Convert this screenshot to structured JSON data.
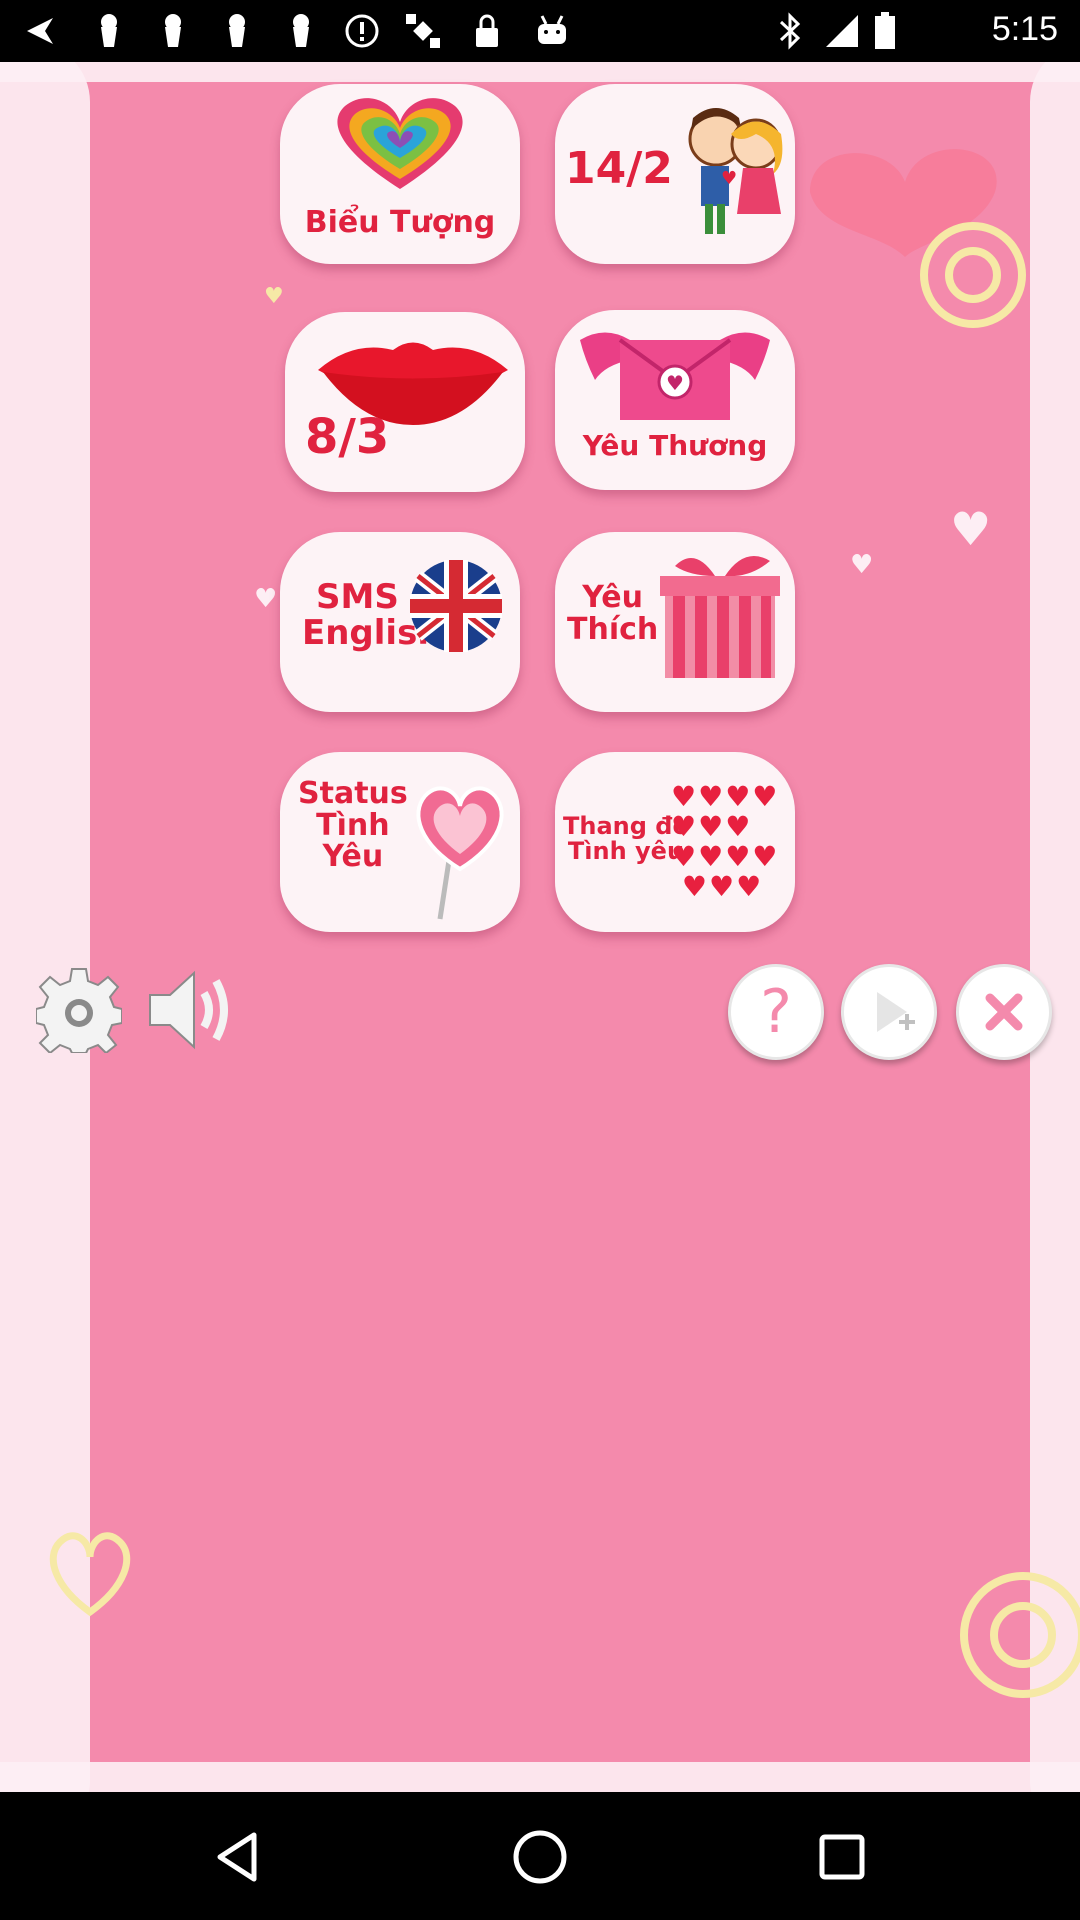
{
  "status_bar": {
    "time": "5:15",
    "icons": [
      "back-arrow-icon",
      "notification-icon",
      "notification-icon",
      "notification-icon",
      "notification-icon",
      "alert-icon",
      "gps-icon",
      "lock-icon",
      "android-icon",
      "bluetooth-icon",
      "signal-icon",
      "battery-icon"
    ]
  },
  "tiles": [
    {
      "id": "bieu-tuong",
      "label": "Biểu Tượng"
    },
    {
      "id": "14-2",
      "label": "14/2"
    },
    {
      "id": "8-3",
      "label": "8/3"
    },
    {
      "id": "yeu-thuong",
      "label": "Yêu Thương"
    },
    {
      "id": "sms-english",
      "line1": "SMS",
      "line2": "English"
    },
    {
      "id": "yeu-thich",
      "line1": "Yêu",
      "line2": "Thích"
    },
    {
      "id": "status-tinh-yeu",
      "line1": "Status",
      "line2": "Tình",
      "line3": "Yêu"
    },
    {
      "id": "thang-do",
      "line1": "Thang đo",
      "line2": "Tình yêu"
    }
  ],
  "controls": {
    "settings_icon": "gear-icon",
    "sound_icon": "speaker-icon",
    "help_icon": "question-icon",
    "more_apps_icon": "play-plus-icon",
    "close_icon": "close-icon"
  },
  "colors": {
    "background": "#f48aac",
    "border": "#fdeef4",
    "tile": "#fdf3f6",
    "tile_text": "#e0223f"
  },
  "nav_bar": {
    "back_icon": "back-triangle-icon",
    "home_icon": "home-circle-icon",
    "recents_icon": "recents-square-icon"
  }
}
